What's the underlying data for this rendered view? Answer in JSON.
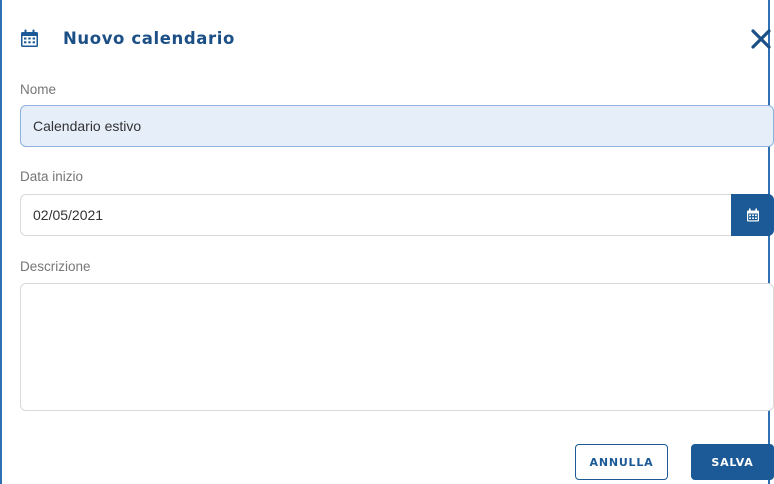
{
  "dialog": {
    "title": "Nuovo calendario",
    "header_icon": "calendar-icon",
    "close_icon": "close-icon"
  },
  "fields": {
    "name": {
      "label": "Nome",
      "value": "Calendario estivo"
    },
    "start_date": {
      "label": "Data inizio",
      "value": "02/05/2021",
      "picker_icon": "calendar-icon"
    },
    "description": {
      "label": "Descrizione",
      "value": ""
    }
  },
  "actions": {
    "cancel_label": "ANNULLA",
    "save_label": "SALVA"
  },
  "colors": {
    "accent": "#1b5a96",
    "title": "#1b4f86",
    "frame_border": "#2f6fb3",
    "focused_input_bg": "#e6eefa"
  }
}
